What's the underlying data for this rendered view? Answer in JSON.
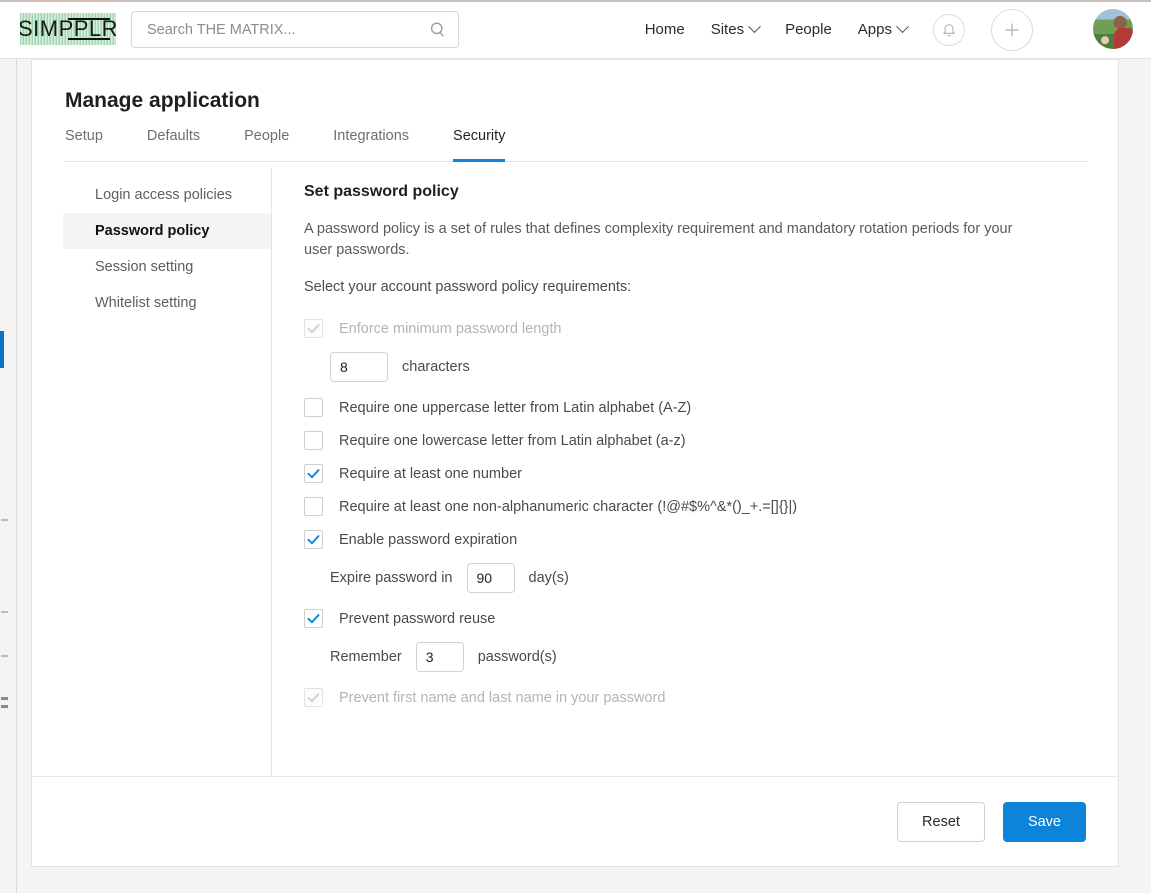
{
  "topbar": {
    "logo_text": "SIMPPLR",
    "search": {
      "value": "",
      "placeholder": "Search THE MATRIX..."
    },
    "nav": [
      {
        "label": "Home",
        "has_caret": false
      },
      {
        "label": "Sites",
        "has_caret": true
      },
      {
        "label": "People",
        "has_caret": false
      },
      {
        "label": "Apps",
        "has_caret": true
      }
    ],
    "icons": {
      "notifications": "bell-icon",
      "create": "plus-icon",
      "avatar": "user-avatar"
    }
  },
  "page": {
    "title": "Manage application",
    "tabs": [
      {
        "label": "Setup",
        "active": false
      },
      {
        "label": "Defaults",
        "active": false
      },
      {
        "label": "People",
        "active": false
      },
      {
        "label": "Integrations",
        "active": false
      },
      {
        "label": "Security",
        "active": true
      }
    ]
  },
  "settings_nav": [
    {
      "label": "Login access policies",
      "active": false
    },
    {
      "label": "Password policy",
      "active": true
    },
    {
      "label": "Session setting",
      "active": false
    },
    {
      "label": "Whitelist setting",
      "active": false
    }
  ],
  "pane": {
    "heading": "Set password policy",
    "description": "A password policy is a set of rules that defines complexity requirement and mandatory rotation periods for your user passwords.",
    "lead": "Select your account password policy requirements:",
    "options": [
      {
        "id": "min-length",
        "label": "Enforce minimum password length",
        "checked": true,
        "disabled": true
      },
      {
        "id": "uppercase",
        "label": "Require one uppercase letter from Latin alphabet (A-Z)",
        "checked": false,
        "disabled": false
      },
      {
        "id": "lowercase",
        "label": "Require one lowercase letter from Latin alphabet (a-z)",
        "checked": false,
        "disabled": false
      },
      {
        "id": "number",
        "label": "Require at least one number",
        "checked": true,
        "disabled": false
      },
      {
        "id": "non-alphanumeric",
        "label": "Require at least one non-alphanumeric character (!@#$%^&*()_+.=[]{}|)",
        "checked": false,
        "disabled": false
      },
      {
        "id": "expiration",
        "label": "Enable password expiration",
        "checked": true,
        "disabled": false
      },
      {
        "id": "reuse",
        "label": "Prevent password reuse",
        "checked": true,
        "disabled": false
      },
      {
        "id": "name-in-password",
        "label": "Prevent first name and last name in your password",
        "checked": true,
        "disabled": true
      }
    ],
    "min_length": {
      "value": "8",
      "unit": "characters"
    },
    "expiration": {
      "prefix": "Expire password in",
      "value": "90",
      "unit": "day(s)"
    },
    "reuse": {
      "prefix": "Remember",
      "value": "3",
      "unit": "password(s)"
    }
  },
  "footer": {
    "reset_label": "Reset",
    "save_label": "Save"
  },
  "colors": {
    "accent": "#0b84d9",
    "tab_underline": "#0b84d9",
    "rail_active": "#0b72c4",
    "logo_green": "#3fa35f"
  }
}
